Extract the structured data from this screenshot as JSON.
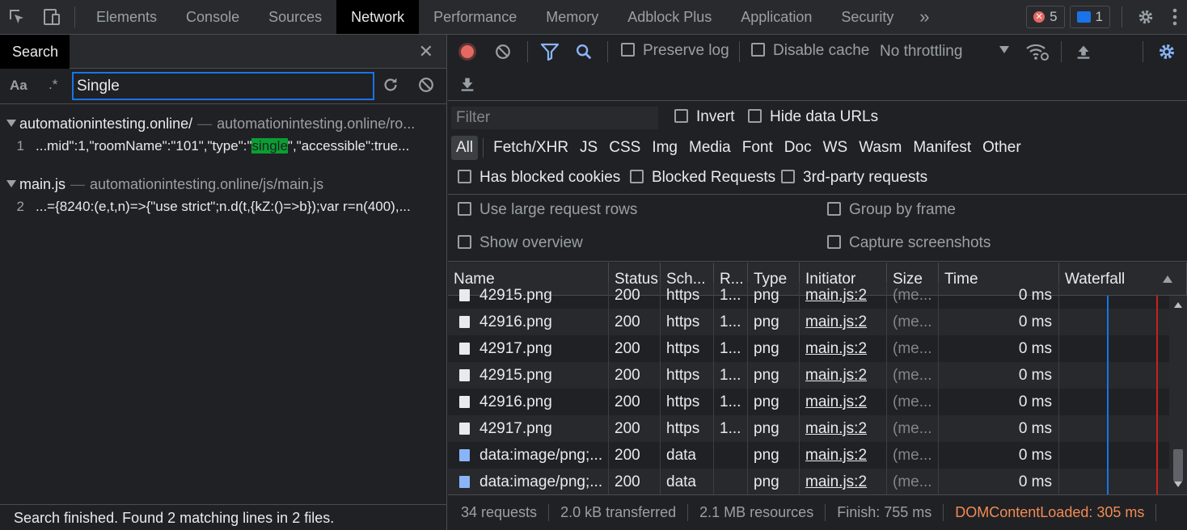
{
  "tabs": [
    "Elements",
    "Console",
    "Sources",
    "Network",
    "Performance",
    "Memory",
    "Adblock Plus",
    "Application",
    "Security"
  ],
  "active_tab": "Network",
  "badges": {
    "errors": "5",
    "messages": "1"
  },
  "search": {
    "tab_label": "Search",
    "case_label": "Aa",
    "regex_label": ".*",
    "query": "Single",
    "results": [
      {
        "file": "automationintesting.online/",
        "path": "automationintesting.online/ro...",
        "line": "1",
        "before": "...mid\":1,\"roomName\":\"101\",\"type\":\"",
        "match": "single",
        "after": "\",\"accessible\":true..."
      },
      {
        "file": "main.js",
        "path": "automationintesting.online/js/main.js",
        "line": "2",
        "before": "...={8240:(e,t,n)=>{\"use strict\";n.d(t,{kZ:()=>b});var r=n(400),...",
        "match": "",
        "after": ""
      }
    ],
    "status": "Search finished.  Found 2 matching lines in 2 files."
  },
  "network": {
    "preserve_log": "Preserve log",
    "disable_cache": "Disable cache",
    "throttling": "No throttling",
    "filter_placeholder": "Filter",
    "invert": "Invert",
    "hide_data_urls": "Hide data URLs",
    "types": [
      "All",
      "Fetch/XHR",
      "JS",
      "CSS",
      "Img",
      "Media",
      "Font",
      "Doc",
      "WS",
      "Wasm",
      "Manifest",
      "Other"
    ],
    "has_blocked_cookies": "Has blocked cookies",
    "blocked_requests": "Blocked Requests",
    "third_party": "3rd-party requests",
    "large_rows": "Use large request rows",
    "group_by_frame": "Group by frame",
    "show_overview": "Show overview",
    "capture_screenshots": "Capture screenshots",
    "columns": [
      "Name",
      "Status",
      "Sch...",
      "R...",
      "Type",
      "Initiator",
      "Size",
      "Time",
      "Waterfall"
    ],
    "rows": [
      {
        "name": "42915.png",
        "status": "200",
        "scheme": "https",
        "r": "1...",
        "type": "png",
        "initiator": "main.js:2",
        "size": "(me...",
        "time": "0 ms",
        "icon": "file-icon"
      },
      {
        "name": "42916.png",
        "status": "200",
        "scheme": "https",
        "r": "1...",
        "type": "png",
        "initiator": "main.js:2",
        "size": "(me...",
        "time": "0 ms",
        "icon": "file-icon"
      },
      {
        "name": "42917.png",
        "status": "200",
        "scheme": "https",
        "r": "1...",
        "type": "png",
        "initiator": "main.js:2",
        "size": "(me...",
        "time": "0 ms",
        "icon": "file-icon"
      },
      {
        "name": "42915.png",
        "status": "200",
        "scheme": "https",
        "r": "1...",
        "type": "png",
        "initiator": "main.js:2",
        "size": "(me...",
        "time": "0 ms",
        "icon": "file-icon"
      },
      {
        "name": "42916.png",
        "status": "200",
        "scheme": "https",
        "r": "1...",
        "type": "png",
        "initiator": "main.js:2",
        "size": "(me...",
        "time": "0 ms",
        "icon": "file-icon"
      },
      {
        "name": "42917.png",
        "status": "200",
        "scheme": "https",
        "r": "1...",
        "type": "png",
        "initiator": "main.js:2",
        "size": "(me...",
        "time": "0 ms",
        "icon": "file-icon"
      },
      {
        "name": "data:image/png;...",
        "status": "200",
        "scheme": "data",
        "r": "",
        "type": "png",
        "initiator": "main.js:2",
        "size": "(me...",
        "time": "0 ms",
        "icon": "image-icon"
      },
      {
        "name": "data:image/png;...",
        "status": "200",
        "scheme": "data",
        "r": "",
        "type": "png",
        "initiator": "main.js:2",
        "size": "(me...",
        "time": "0 ms",
        "icon": "image-icon"
      }
    ],
    "summary": {
      "requests": "34 requests",
      "transferred": "2.0 kB transferred",
      "resources": "2.1 MB resources",
      "finish": "Finish: 755 ms",
      "dcl": "DOMContentLoaded: 305 ms"
    }
  }
}
